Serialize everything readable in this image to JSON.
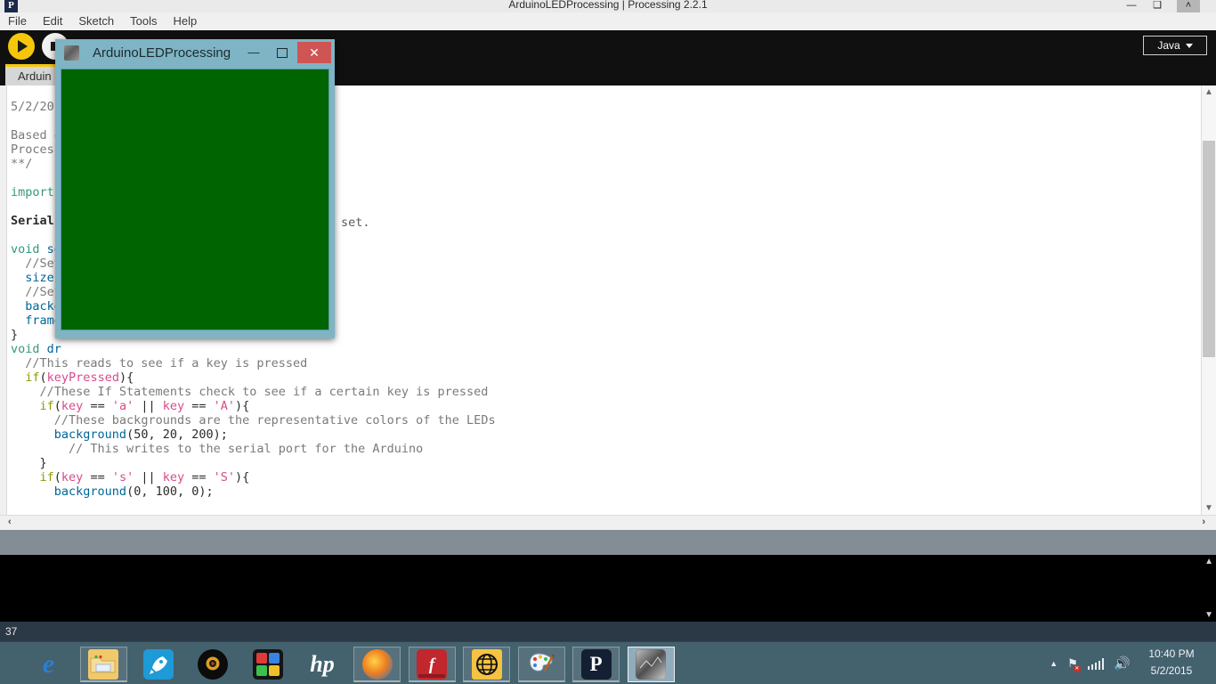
{
  "window": {
    "title": "ArduinoLEDProcessing | Processing 2.2.1",
    "app_icon_letter": "P",
    "minimize": "—",
    "maximize": "❑",
    "close": "˄"
  },
  "menubar": {
    "items": [
      {
        "label": "File"
      },
      {
        "label": "Edit"
      },
      {
        "label": "Sketch"
      },
      {
        "label": "Tools"
      },
      {
        "label": "Help"
      }
    ]
  },
  "toolbar": {
    "run_icon": "play-icon",
    "stop_icon": "stop-icon",
    "mode_label": "Java"
  },
  "tabbar": {
    "sketch_tab_label": "Arduin"
  },
  "editor": {
    "lines": [
      {
        "indent": 0,
        "tokens": [
          {
            "t": "5/2/201",
            "c": "k-comment"
          }
        ]
      },
      {
        "indent": 0,
        "tokens": []
      },
      {
        "indent": 0,
        "tokens": [
          {
            "t": "Based o",
            "c": "k-comment"
          }
        ]
      },
      {
        "indent": 0,
        "tokens": [
          {
            "t": "Process",
            "c": "k-comment"
          }
        ]
      },
      {
        "indent": 0,
        "tokens": [
          {
            "t": "**/",
            "c": "k-comment"
          }
        ]
      },
      {
        "indent": 0,
        "tokens": []
      },
      {
        "indent": 0,
        "tokens": [
          {
            "t": "import",
            "c": "k-import"
          }
        ]
      },
      {
        "indent": 0,
        "tokens": []
      },
      {
        "indent": 0,
        "tokens": [
          {
            "t": "Serial",
            "c": "k-type"
          }
        ]
      },
      {
        "indent": 0,
        "tokens": []
      },
      {
        "indent": 0,
        "tokens": [
          {
            "t": "void ",
            "c": "k-void"
          },
          {
            "t": "se",
            "c": "k-fn"
          }
        ]
      },
      {
        "indent": 2,
        "tokens": [
          {
            "t": "//Set",
            "c": "k-comment"
          }
        ]
      },
      {
        "indent": 2,
        "tokens": [
          {
            "t": "size(",
            "c": "k-fn"
          }
        ]
      },
      {
        "indent": 2,
        "tokens": [
          {
            "t": "//Set",
            "c": "k-comment"
          }
        ]
      },
      {
        "indent": 2,
        "tokens": [
          {
            "t": "backg",
            "c": "k-fn"
          }
        ]
      },
      {
        "indent": 2,
        "tokens": [
          {
            "t": "frame",
            "c": "k-fn"
          }
        ]
      },
      {
        "indent": 0,
        "tokens": [
          {
            "t": "}",
            "c": "k-punct"
          }
        ]
      },
      {
        "indent": 0,
        "tokens": [
          {
            "t": "void ",
            "c": "k-void"
          },
          {
            "t": "dr",
            "c": "k-fn"
          }
        ]
      },
      {
        "indent": 2,
        "tokens": [
          {
            "t": "//This reads to see if a key is pressed",
            "c": "k-comment"
          }
        ]
      },
      {
        "indent": 2,
        "tokens": [
          {
            "t": "if",
            "c": "k-if"
          },
          {
            "t": "(",
            "c": "k-punct"
          },
          {
            "t": "keyPressed",
            "c": "k-kw"
          },
          {
            "t": "){",
            "c": "k-punct"
          }
        ]
      },
      {
        "indent": 4,
        "tokens": [
          {
            "t": "//These If Statements check to see if a certain key is pressed",
            "c": "k-comment"
          }
        ]
      },
      {
        "indent": 4,
        "tokens": [
          {
            "t": "if",
            "c": "k-if"
          },
          {
            "t": "(",
            "c": "k-punct"
          },
          {
            "t": "key",
            "c": "k-kw"
          },
          {
            "t": " == ",
            "c": "k-punct"
          },
          {
            "t": "'a'",
            "c": "k-kw"
          },
          {
            "t": " || ",
            "c": "k-punct"
          },
          {
            "t": "key",
            "c": "k-kw"
          },
          {
            "t": " == ",
            "c": "k-punct"
          },
          {
            "t": "'A'",
            "c": "k-kw"
          },
          {
            "t": "){",
            "c": "k-punct"
          }
        ]
      },
      {
        "indent": 6,
        "tokens": [
          {
            "t": "//These backgrounds are the representative colors of the LEDs",
            "c": "k-comment"
          }
        ]
      },
      {
        "indent": 6,
        "tokens": [
          {
            "t": "background",
            "c": "k-fn"
          },
          {
            "t": "(",
            "c": "k-punct"
          },
          {
            "t": "50, 20, 200",
            "c": "k-num"
          },
          {
            "t": ");",
            "c": "k-punct"
          }
        ]
      },
      {
        "indent": 8,
        "tokens": [
          {
            "t": "// This writes to the serial port for the Arduino",
            "c": "k-comment"
          }
        ]
      },
      {
        "indent": 4,
        "tokens": [
          {
            "t": "}",
            "c": "k-punct"
          }
        ]
      },
      {
        "indent": 4,
        "tokens": [
          {
            "t": "if",
            "c": "k-if"
          },
          {
            "t": "(",
            "c": "k-punct"
          },
          {
            "t": "key",
            "c": "k-kw"
          },
          {
            "t": " == ",
            "c": "k-punct"
          },
          {
            "t": "'s'",
            "c": "k-kw"
          },
          {
            "t": " || ",
            "c": "k-punct"
          },
          {
            "t": "key",
            "c": "k-kw"
          },
          {
            "t": " == ",
            "c": "k-punct"
          },
          {
            "t": "'S'",
            "c": "k-kw"
          },
          {
            "t": "){",
            "c": "k-punct"
          }
        ]
      },
      {
        "indent": 6,
        "tokens": [
          {
            "t": "background",
            "c": "k-fn"
          },
          {
            "t": "(",
            "c": "k-punct"
          },
          {
            "t": "0, 100, 0",
            "c": "k-num"
          },
          {
            "t": ");",
            "c": "k-punct"
          }
        ]
      },
      {
        "indent": 0,
        "tokens": []
      },
      {
        "indent": 4,
        "tokens": [
          {
            "t": "}",
            "c": "k-punct"
          }
        ]
      }
    ],
    "right_fragment": "set.",
    "scrollbar_up_arrow": "▲",
    "scrollbar_down_arrow": "▼",
    "hscroll_left_arrow": "‹",
    "hscroll_right_arrow": "›"
  },
  "status": {
    "line_number": "37"
  },
  "sketch_window": {
    "title": "ArduinoLEDProcessing",
    "minimize": "—",
    "maximize": "□",
    "close": "✕",
    "canvas_color": "#006400",
    "frame_color": "#7eb4c4"
  },
  "taskbar": {
    "items": [
      {
        "name": "internet-explorer",
        "glyph": "e",
        "cls": "g-ie",
        "state": "pinned"
      },
      {
        "name": "file-explorer",
        "glyph": "",
        "cls": "g-exp",
        "state": "running"
      },
      {
        "name": "rocket-launcher",
        "glyph": "↗",
        "cls": "g-rock",
        "state": "pinned"
      },
      {
        "name": "media-player",
        "glyph": "◉",
        "cls": "g-disc",
        "state": "pinned"
      },
      {
        "name": "puzzle-app",
        "glyph": "",
        "cls": "g-puz",
        "state": "pinned"
      },
      {
        "name": "hp-support",
        "glyph": "hp",
        "cls": "g-hp",
        "state": "pinned"
      },
      {
        "name": "firefox",
        "glyph": "",
        "cls": "g-ff",
        "state": "running"
      },
      {
        "name": "f-red-app",
        "glyph": "f",
        "cls": "g-f",
        "state": "running"
      },
      {
        "name": "globe-browser",
        "glyph": "⊕",
        "cls": "g-glob",
        "state": "running"
      },
      {
        "name": "paint-app",
        "glyph": "🎨",
        "cls": "g-paint",
        "state": "running"
      },
      {
        "name": "processing-p",
        "glyph": "P",
        "cls": "g-P",
        "state": "running"
      },
      {
        "name": "processing-sketch",
        "glyph": "",
        "cls": "g-proc",
        "state": "active"
      }
    ],
    "tray": {
      "show_hidden": "▲",
      "network_icon": "network-error-icon",
      "signal_icon": "signal-bars-icon",
      "volume_icon": "🔊"
    },
    "clock": {
      "time": "10:40 PM",
      "date": "5/2/2015"
    }
  }
}
